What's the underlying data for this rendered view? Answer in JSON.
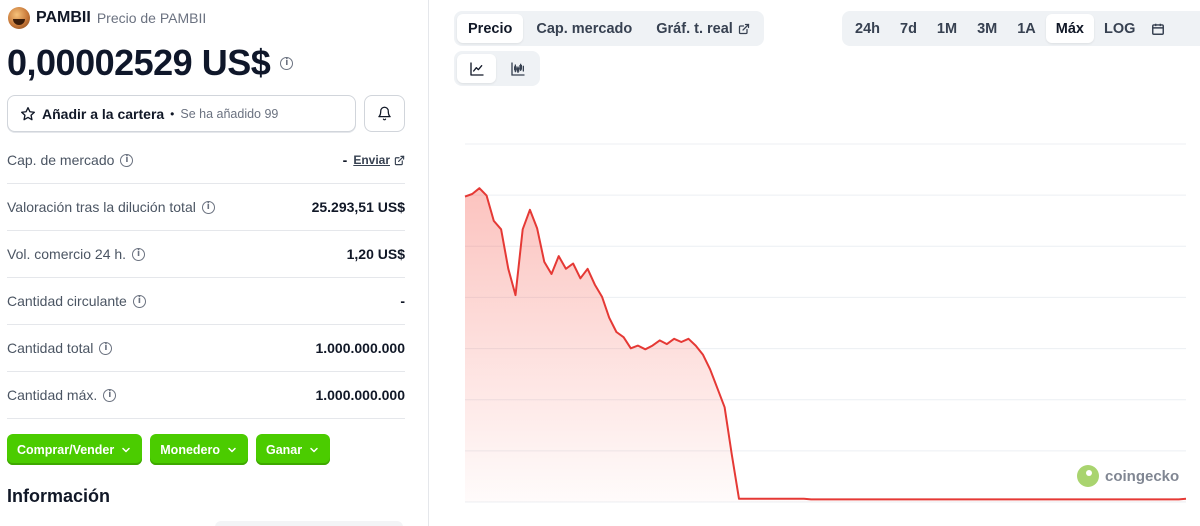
{
  "coin": {
    "name": "PAMBII",
    "subtitle": "Precio de PAMBII",
    "price": "0,00002529 US$"
  },
  "portfolio": {
    "label": "Añadir a la cartera",
    "separator": "•",
    "added_text": "Se ha añadido 99"
  },
  "stats": [
    {
      "label": "Cap. de mercado",
      "value": "-",
      "link": "Enviar"
    },
    {
      "label": "Valoración tras la dilución total",
      "value": "25.293,51 US$"
    },
    {
      "label": "Vol. comercio 24 h.",
      "value": "1,20 US$"
    },
    {
      "label": "Cantidad circulante",
      "value": "-"
    },
    {
      "label": "Cantidad total",
      "value": "1.000.000.000"
    },
    {
      "label": "Cantidad máx.",
      "value": "1.000.000.000"
    }
  ],
  "actions": [
    {
      "label": "Comprar/Vender"
    },
    {
      "label": "Monedero"
    },
    {
      "label": "Ganar"
    }
  ],
  "section_title": "Información",
  "chart_tabs": [
    {
      "label": "Precio",
      "active": true
    },
    {
      "label": "Cap. mercado",
      "active": false
    },
    {
      "label": "Gráf. t. real",
      "active": false,
      "external": true
    }
  ],
  "ranges": [
    {
      "label": "24h",
      "active": false
    },
    {
      "label": "7d",
      "active": false
    },
    {
      "label": "1M",
      "active": false
    },
    {
      "label": "3M",
      "active": false
    },
    {
      "label": "1A",
      "active": false
    },
    {
      "label": "Máx",
      "active": true
    },
    {
      "label": "LOG",
      "active": false
    }
  ],
  "chart_types": [
    {
      "icon": "line-chart-icon",
      "active": true
    },
    {
      "icon": "candlestick-icon",
      "active": false
    }
  ],
  "watermark": "coingecko",
  "colors": {
    "accent_green": "#4bcc00",
    "line_red": "#e53935",
    "tab_bg": "#eff2f5"
  },
  "chart_data": {
    "type": "area",
    "title": "",
    "xlabel": "",
    "ylabel": "",
    "grid": true,
    "legend": "none",
    "ylim": [
      0,
      6.8e-05
    ],
    "x": [
      0,
      1,
      2,
      3,
      4,
      5,
      6,
      7,
      8,
      9,
      10,
      11,
      12,
      13,
      14,
      15,
      16,
      17,
      18,
      19,
      20,
      21,
      22,
      23,
      24,
      25,
      26,
      27,
      28,
      29,
      30,
      31,
      32,
      33,
      34,
      35,
      36,
      37,
      38,
      39,
      40,
      41,
      42,
      43,
      44,
      45,
      46,
      47,
      48,
      49,
      50,
      51,
      52,
      53,
      54,
      55,
      56,
      57,
      58,
      59,
      60,
      61,
      62,
      63,
      64,
      65,
      66,
      67,
      68,
      69,
      70,
      71,
      72,
      73,
      74,
      75,
      76,
      77,
      78,
      79,
      80,
      81,
      82,
      83,
      84,
      85,
      86,
      87,
      88,
      89,
      90,
      91,
      92,
      93,
      94,
      95,
      96,
      97,
      98,
      99,
      100
    ],
    "series": [
      {
        "values": [
          5.8e-05,
          5.85e-05,
          5.96e-05,
          5.82e-05,
          5.34e-05,
          5.18e-05,
          4.43e-05,
          3.93e-05,
          5.18e-05,
          5.55e-05,
          5.2e-05,
          4.56e-05,
          4.33e-05,
          4.67e-05,
          4.43e-05,
          4.53e-05,
          4.25e-05,
          4.43e-05,
          4.13e-05,
          3.9e-05,
          3.5e-05,
          3.23e-05,
          3.13e-05,
          2.92e-05,
          2.97e-05,
          2.9e-05,
          2.97e-05,
          3.07e-05,
          3e-05,
          3.1e-05,
          3.04e-05,
          3.1e-05,
          2.97e-05,
          2.8e-05,
          2.52e-05,
          2.16e-05,
          1.8e-05,
          9e-06,
          6e-07,
          6e-07,
          6e-07,
          6e-07,
          6e-07,
          6e-07,
          6e-07,
          6e-07,
          6e-07,
          6e-07,
          5e-07,
          5e-07,
          5e-07,
          5e-07,
          5e-07,
          5e-07,
          5e-07,
          5e-07,
          5e-07,
          5e-07,
          5e-07,
          5e-07,
          5e-07,
          5e-07,
          5e-07,
          5e-07,
          5e-07,
          5e-07,
          5e-07,
          5e-07,
          5e-07,
          5e-07,
          5e-07,
          5e-07,
          5e-07,
          5e-07,
          5e-07,
          5e-07,
          5e-07,
          5e-07,
          5e-07,
          5e-07,
          5e-07,
          5e-07,
          5e-07,
          5e-07,
          5e-07,
          5e-07,
          5e-07,
          5e-07,
          5e-07,
          5e-07,
          5e-07,
          5e-07,
          5e-07,
          5e-07,
          5e-07,
          5e-07,
          5e-07,
          5e-07,
          5e-07,
          5e-07,
          6e-07
        ]
      }
    ]
  }
}
